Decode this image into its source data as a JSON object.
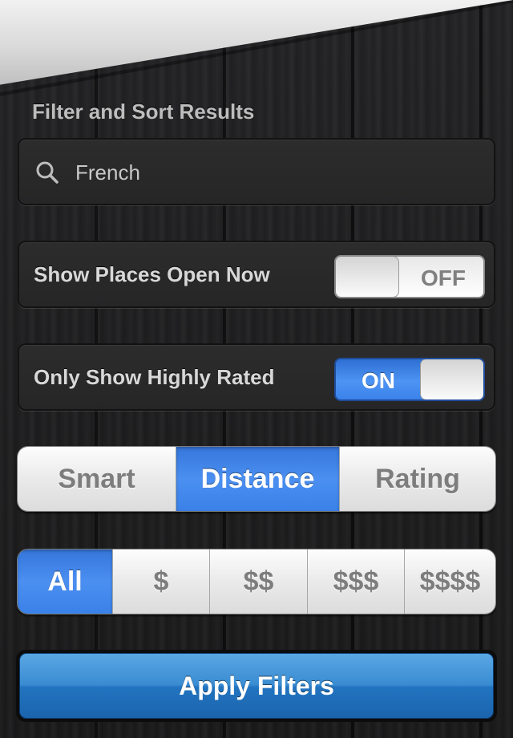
{
  "header": {
    "title": "Filter and Sort Results"
  },
  "search": {
    "value": "French",
    "icon": "search-icon"
  },
  "toggles": [
    {
      "label": "Show Places Open Now",
      "state_text": "OFF",
      "on": false
    },
    {
      "label": "Only Show Highly Rated",
      "state_text": "ON",
      "on": true
    }
  ],
  "sort": {
    "options": [
      "Smart",
      "Distance",
      "Rating"
    ],
    "selected": "Distance"
  },
  "price": {
    "options": [
      "All",
      "$",
      "$$",
      "$$$",
      "$$$$"
    ],
    "selected": "All"
  },
  "apply": {
    "label": "Apply Filters"
  },
  "colors": {
    "accent_blue": "#3a82ea",
    "apply_blue": "#2274c0",
    "panel": "#2a2a2b",
    "background": "#1b1b1c"
  }
}
